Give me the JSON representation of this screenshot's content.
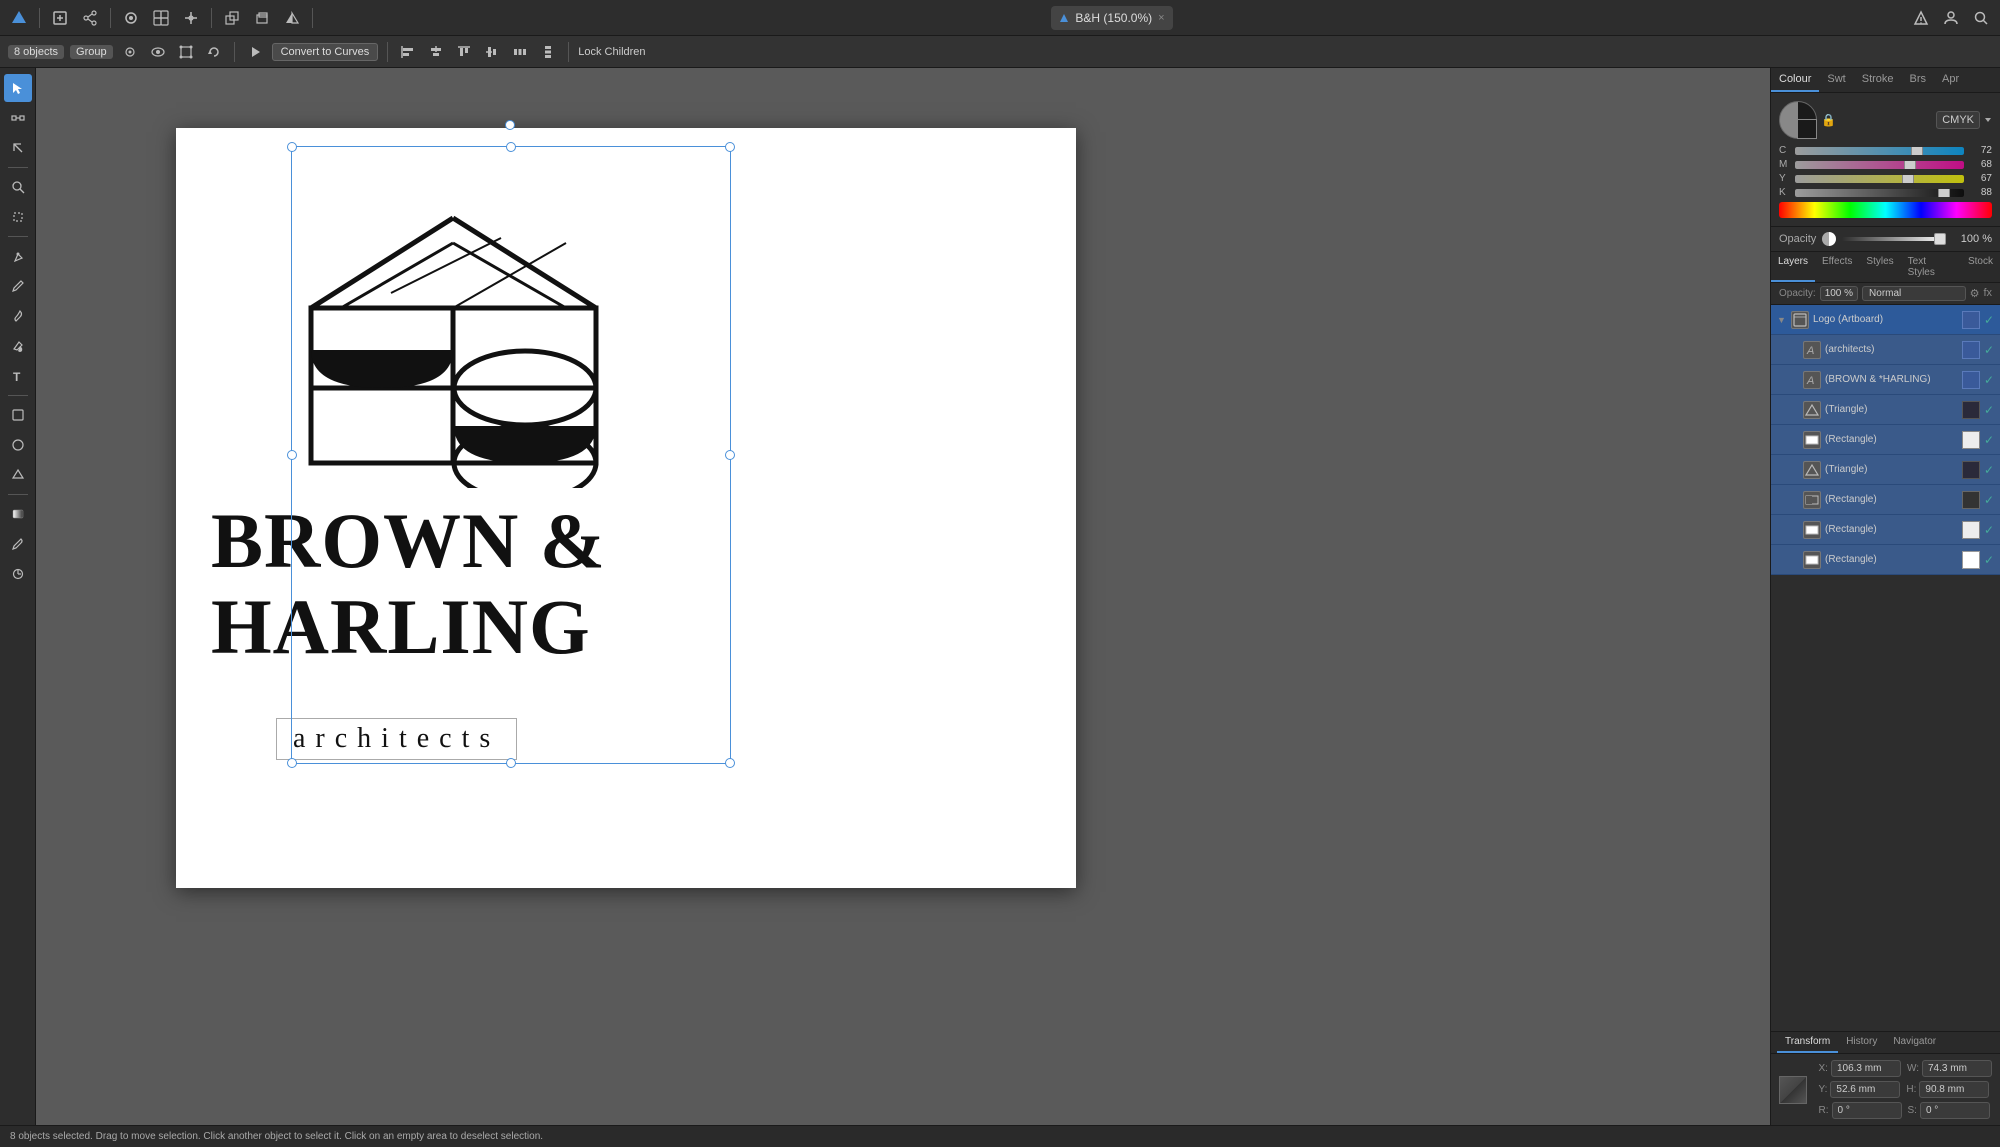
{
  "app": {
    "title": "B&H (150.0%)",
    "close_label": "×"
  },
  "top_toolbar": {
    "icons": [
      "grid",
      "share",
      "circle",
      "pen",
      "grid2",
      "arrow",
      "shape",
      "plus",
      "minus",
      "arrange1",
      "arrange2",
      "arrange3",
      "arrange4",
      "arrow_left",
      "frame",
      "export"
    ],
    "title": "B&H (150.0%)"
  },
  "context_toolbar": {
    "objects_count": "8 objects",
    "group_label": "Group",
    "convert_btn": "Convert to Curves",
    "lock_label": "Lock Children"
  },
  "color_panel": {
    "tab_colour": "Colour",
    "tab_swt": "Swt",
    "tab_stroke": "Stroke",
    "tab_brs": "Brs",
    "tab_apr": "Apr",
    "mode": "CMYK",
    "c_val": "72",
    "m_val": "68",
    "y_val": "67",
    "k_val": "88",
    "c_pct": 72,
    "m_pct": 68,
    "y_pct": 67,
    "k_pct": 88,
    "opacity_label": "Opacity",
    "opacity_val": "100 %"
  },
  "layers_panel": {
    "tab_layers": "Layers",
    "tab_effects": "Effects",
    "tab_styles": "Styles",
    "tab_text_styles": "Text Styles",
    "tab_stock": "Stock",
    "opacity_val": "100 %",
    "mode_val": "Normal",
    "items": [
      {
        "name": "Logo (Artboard)",
        "type": "artboard",
        "indent": 0,
        "top": true
      },
      {
        "name": "(architects)",
        "type": "text",
        "indent": 1
      },
      {
        "name": "(BROWN & *HARLING)",
        "type": "text",
        "indent": 1
      },
      {
        "name": "(Triangle)",
        "type": "triangle",
        "indent": 1
      },
      {
        "name": "(Rectangle)",
        "type": "rect_white",
        "indent": 1
      },
      {
        "name": "(Triangle)",
        "type": "triangle",
        "indent": 1
      },
      {
        "name": "(Rectangle)",
        "type": "rect_half",
        "indent": 1
      },
      {
        "name": "(Rectangle)",
        "type": "rect_white2",
        "indent": 1
      },
      {
        "name": "(Rectangle)",
        "type": "rect_white3",
        "indent": 1
      }
    ]
  },
  "bottom_panel": {
    "tab_transform": "Transform",
    "tab_history": "History",
    "tab_navigator": "Navigator",
    "x_label": "X:",
    "x_val": "106.3 mm",
    "y_label": "Y:",
    "y_val": "52.6 mm",
    "w_label": "W:",
    "w_val": "74.3 mm",
    "h_label": "H:",
    "h_val": "90.8 mm",
    "r_label": "R:",
    "r_val": "0 °",
    "s_label": "S:",
    "s_val": "0 °"
  },
  "status_bar": {
    "text": "8 objects selected.  Drag to move selection.  Click another object to select it.  Click on an empty area to deselect selection."
  },
  "logo": {
    "company_name": "BROWN &",
    "company_name2": "HARLING",
    "subtitle": "architects"
  }
}
